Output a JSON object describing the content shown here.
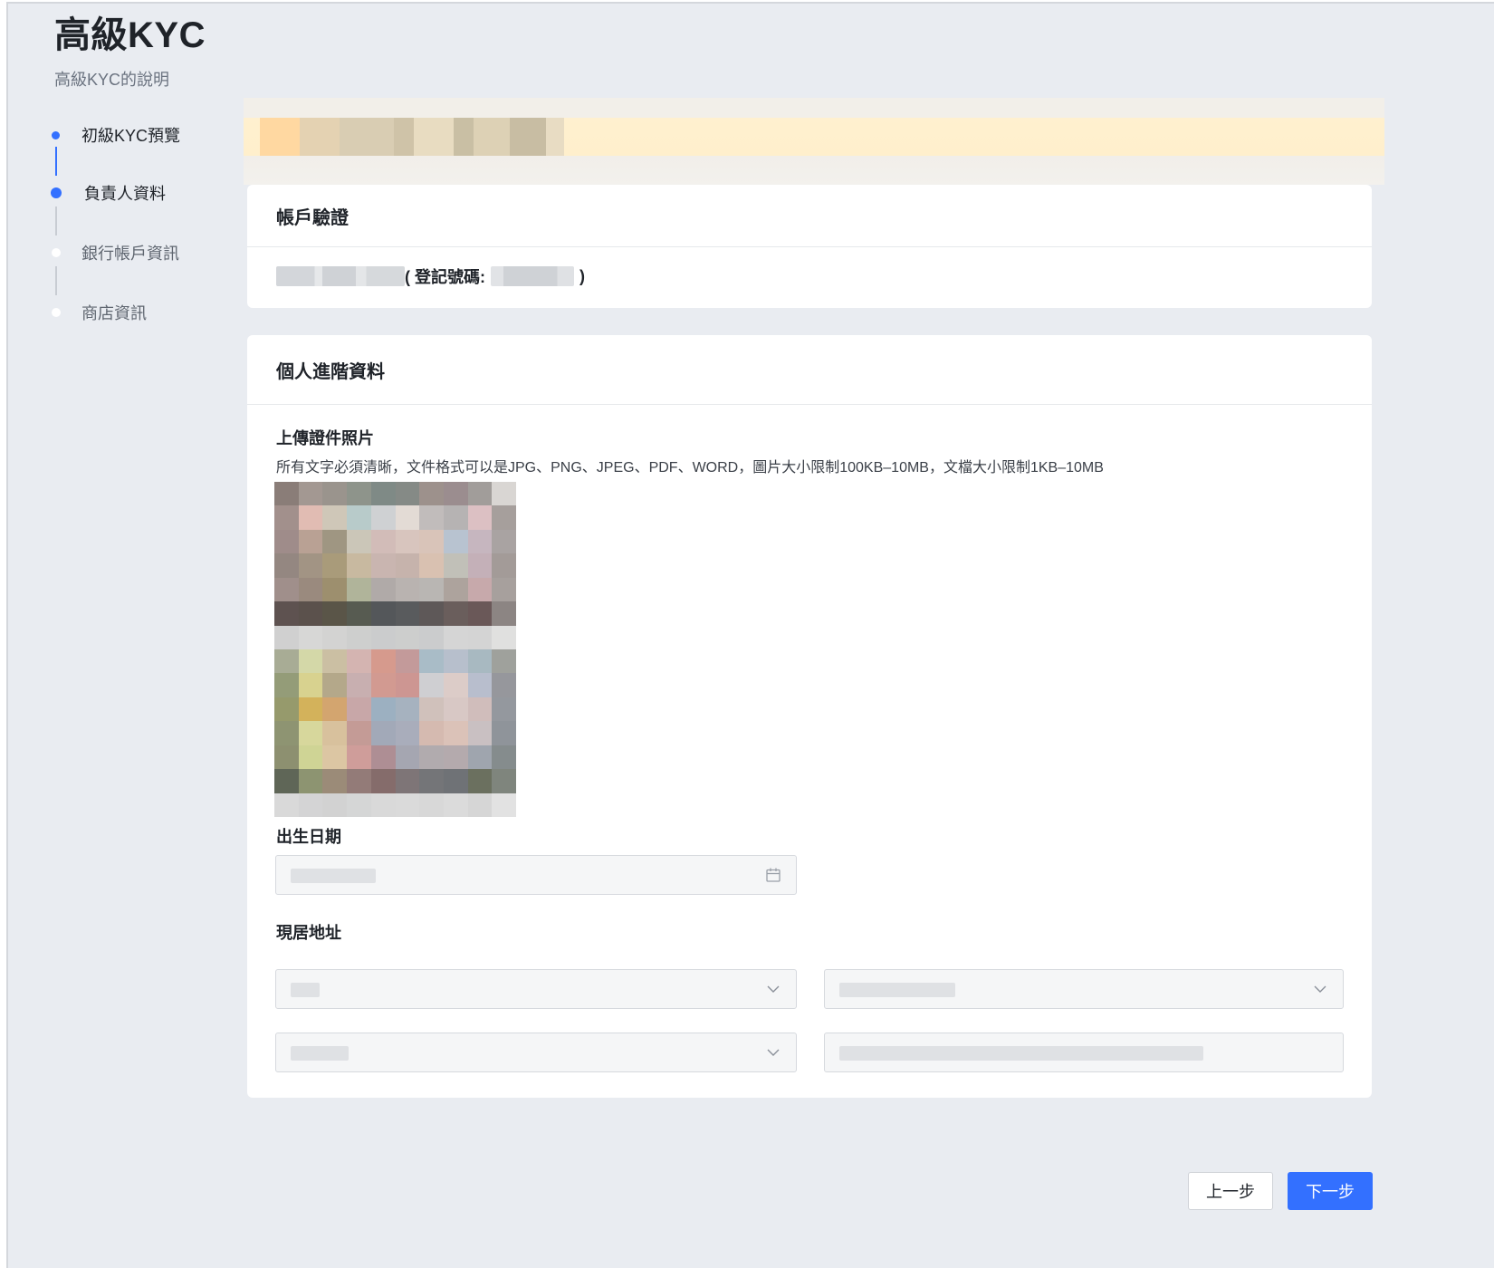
{
  "page": {
    "title": "高級KYC",
    "subtitle": "高級KYC的說明"
  },
  "steps": [
    {
      "label": "初級KYC預覽",
      "state": "done"
    },
    {
      "label": "負責人資料",
      "state": "active"
    },
    {
      "label": "銀行帳戶資訊",
      "state": "todo"
    },
    {
      "label": "商店資訊",
      "state": "todo"
    }
  ],
  "account_verification": {
    "title": "帳戶驗證",
    "reg_open": "( 登記號碼:",
    "reg_close": ")"
  },
  "personal_info": {
    "title": "個人進階資料",
    "upload_label": "上傳證件照片",
    "upload_help": "所有文字必須清晰，文件格式可以是JPG、PNG、JPEG、PDF、WORD，圖片大小限制100KB–10MB，文檔大小限制1KB–10MB",
    "birth_label": "出生日期",
    "address_label": "現居地址"
  },
  "icons": {
    "calendar": "calendar-icon",
    "chevron": "chevron-down-icon"
  },
  "buttons": {
    "prev": "上一步",
    "next": "下一步"
  },
  "colors": {
    "primary": "#3370ff",
    "banner": "#ffefcc"
  }
}
